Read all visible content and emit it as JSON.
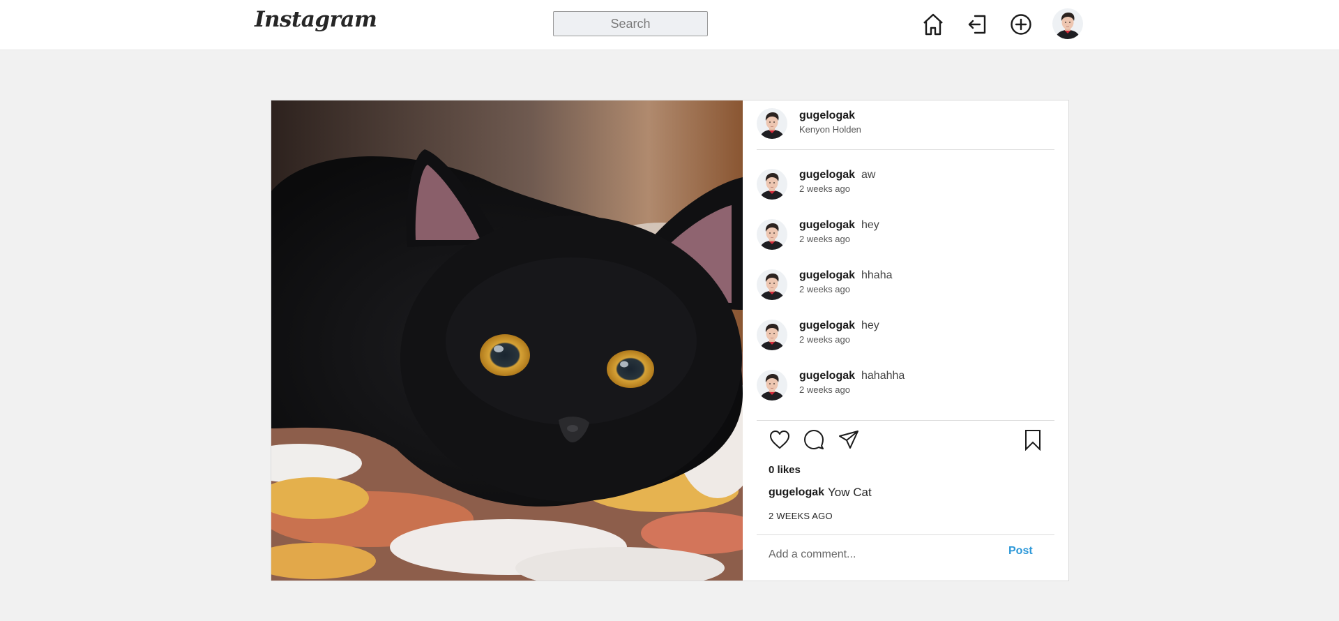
{
  "brand": {
    "logo_text": "Instagram"
  },
  "nav": {
    "search_placeholder": "Search",
    "icons": [
      "home-icon",
      "logout-icon",
      "add-post-icon"
    ]
  },
  "post": {
    "owner": {
      "username": "gugelogak",
      "full_name": "Kenyon Holden"
    },
    "image_subject": "black cat lying on a patterned blanket",
    "comments": [
      {
        "username": "gugelogak",
        "text": "aw",
        "time": "2 weeks ago"
      },
      {
        "username": "gugelogak",
        "text": "hey",
        "time": "2 weeks ago"
      },
      {
        "username": "gugelogak",
        "text": "hhaha",
        "time": "2 weeks ago"
      },
      {
        "username": "gugelogak",
        "text": "hey",
        "time": "2 weeks ago"
      },
      {
        "username": "gugelogak",
        "text": "hahahha",
        "time": "2 weeks ago"
      }
    ],
    "likes_text": "0 likes",
    "caption": {
      "username": "gugelogak",
      "text": "Yow Cat"
    },
    "timestamp": "2 WEEKS AGO",
    "comment_placeholder": "Add a comment...",
    "post_label": "Post"
  },
  "colors": {
    "accent": "#2b97d8",
    "background": "#f1f1f1",
    "card": "#ffffff",
    "border": "#dbdbdb"
  }
}
